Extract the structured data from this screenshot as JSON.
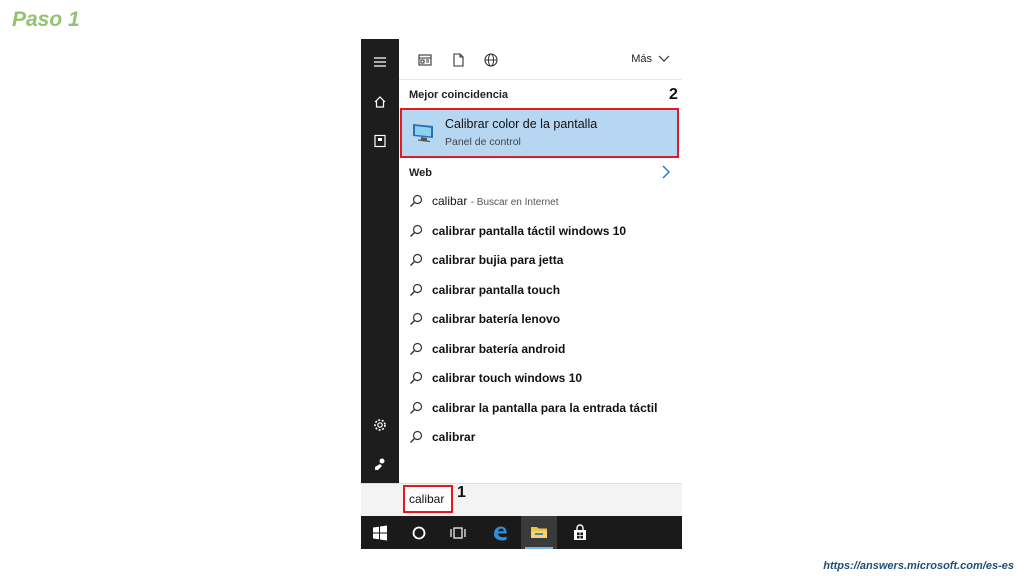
{
  "slide": {
    "title": "Paso 1",
    "source_url": "https://answers.microsoft.com/es-es"
  },
  "rail": {
    "icons": [
      "hamburger-icon",
      "home-icon",
      "notebook-icon",
      "settings-icon",
      "feedback-icon"
    ]
  },
  "topbar": {
    "filters": [
      "apps-filter-icon",
      "documents-filter-icon",
      "web-filter-icon"
    ],
    "more_label": "Más"
  },
  "best_match": {
    "section_label": "Mejor coincidencia",
    "title": "Calibrar color de la pantalla",
    "subtitle": "Panel de control",
    "marker": "2"
  },
  "web": {
    "section_label": "Web",
    "first_suggestion": "calibar",
    "first_suggestion_hint": "- Buscar en Internet",
    "suggestions": [
      "calibrar pantalla táctil windows 10",
      "calibrar bujia para jetta",
      "calibrar pantalla touch",
      "calibrar batería lenovo",
      "calibrar batería android",
      "calibrar touch windows 10",
      "calibrar la pantalla para la entrada táctil",
      "calibrar"
    ]
  },
  "search": {
    "value": "calibar",
    "marker": "1"
  },
  "taskbar": {
    "icons": [
      "windows-start-icon",
      "cortana-icon",
      "task-view-icon",
      "edge-icon",
      "file-explorer-icon",
      "store-icon"
    ]
  },
  "colors": {
    "highlight_red": "#e01a23",
    "selected_blue": "#b7d6f2",
    "title_green": "#92c36e",
    "url_blue": "#1f4e79"
  }
}
